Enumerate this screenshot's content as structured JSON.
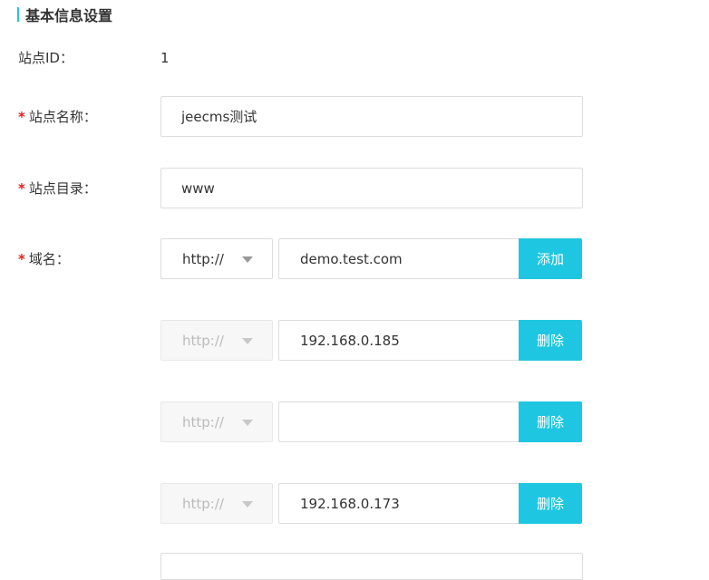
{
  "colors": {
    "accent": "#1fc6e1",
    "required": "#e02020"
  },
  "section": {
    "title": "基本信息设置"
  },
  "site_id": {
    "label": "站点ID：",
    "value": "1"
  },
  "site_name": {
    "required_mark": "*",
    "label": "站点名称：",
    "value": "jeecms测试"
  },
  "site_dir": {
    "required_mark": "*",
    "label": "站点目录：",
    "value": "www"
  },
  "domain": {
    "required_mark": "*",
    "label": "域名：",
    "rows": [
      {
        "protocol": "http://",
        "value": "demo.test.com",
        "button": "添加"
      },
      {
        "protocol": "http://",
        "value": "192.168.0.185",
        "button": "删除"
      },
      {
        "protocol": "http://",
        "value": "",
        "button": "删除"
      },
      {
        "protocol": "http://",
        "value": "192.168.0.173",
        "button": "删除"
      }
    ]
  }
}
